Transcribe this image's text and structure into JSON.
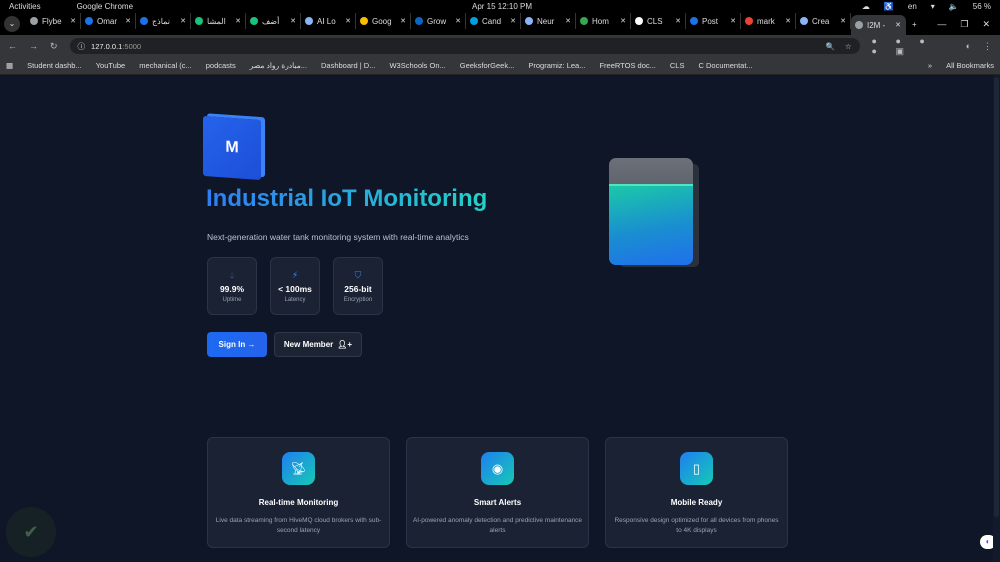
{
  "system": {
    "activities": "Activities",
    "app": "Google Chrome",
    "datetime": "Apr 15  12:10 PM",
    "lang": "en",
    "battery": "56 %"
  },
  "tabs": [
    {
      "label": "Flybe",
      "color": "#9aa0a6"
    },
    {
      "label": "Omar",
      "color": "#1a73e8"
    },
    {
      "label": "نماذج",
      "color": "#1a73e8"
    },
    {
      "label": "المشا",
      "color": "#19c37d"
    },
    {
      "label": "أضف",
      "color": "#19c37d"
    },
    {
      "label": "AI Lo",
      "color": "#8ab4f8"
    },
    {
      "label": "Goog",
      "color": "#fbbc04"
    },
    {
      "label": "Grow",
      "color": "#0a66c2"
    },
    {
      "label": "Cand",
      "color": "#00a1e0"
    },
    {
      "label": "Neur",
      "color": "#8ab4f8"
    },
    {
      "label": "Hom",
      "color": "#34a853"
    },
    {
      "label": "CLS",
      "color": "#ffffff"
    },
    {
      "label": "Post",
      "color": "#1a73e8"
    },
    {
      "label": "mark",
      "color": "#ea4335"
    },
    {
      "label": "Crea",
      "color": "#8ab4f8"
    },
    {
      "label": "I2M -",
      "color": "#9aa0a6",
      "active": true
    }
  ],
  "address": {
    "host": "127.0.0.1",
    "port": ":5000"
  },
  "bookmarks": [
    "Student dashb...",
    "YouTube",
    "mechanical (c...",
    "podcasts",
    "مبادرة رواد مصر...",
    "Dashboard | D...",
    "W3Schools On...",
    "GeeksforGeek...",
    "Programiz: Lea...",
    "FreeRTOS doc...",
    "CLS",
    "C Documentat..."
  ],
  "bookmarks_all": "All Bookmarks",
  "hero": {
    "logo_letter": "M",
    "title": "Industrial IoT Monitoring",
    "subtitle": "Next-generation water tank monitoring system with real-time analytics",
    "stats": [
      {
        "icon": "droplet-icon",
        "value": "99.9%",
        "label": "Uptime"
      },
      {
        "icon": "bolt-icon",
        "value": "< 100ms",
        "label": "Latency"
      },
      {
        "icon": "shield-icon",
        "value": "256-bit",
        "label": "Encryption"
      }
    ],
    "signin": "Sign In →",
    "new_member": "New Member",
    "tank_level_percent": 76
  },
  "features": [
    {
      "icon": "satellite-dish-icon",
      "title": "Real-time Monitoring",
      "desc": "Live data streaming from HiveMQ cloud brokers with sub-second latency"
    },
    {
      "icon": "brain-icon",
      "title": "Smart Alerts",
      "desc": "AI-powered anomaly detection and predictive maintenance alerts"
    },
    {
      "icon": "mobile-icon",
      "title": "Mobile Ready",
      "desc": "Responsive design optimized for all devices from phones to 4K displays"
    }
  ]
}
